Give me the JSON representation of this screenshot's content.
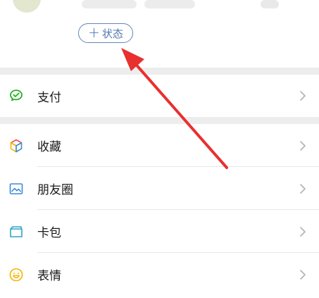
{
  "profile": {
    "status_button": {
      "plus": "+",
      "label": "状态"
    }
  },
  "menu": {
    "pay": {
      "label": "支付",
      "icon": "wechat-pay-icon",
      "color": "#1aad19"
    },
    "items": [
      {
        "label": "收藏",
        "icon": "favorites-cube-icon"
      },
      {
        "label": "朋友圈",
        "icon": "moments-picture-icon",
        "color": "#3c8ad8"
      },
      {
        "label": "卡包",
        "icon": "card-wallet-icon",
        "color": "#2fa6c2"
      },
      {
        "label": "表情",
        "icon": "sticker-smiley-icon",
        "color": "#f4b400"
      }
    ]
  },
  "annotation": {
    "arrow_color": "#e8302f"
  }
}
